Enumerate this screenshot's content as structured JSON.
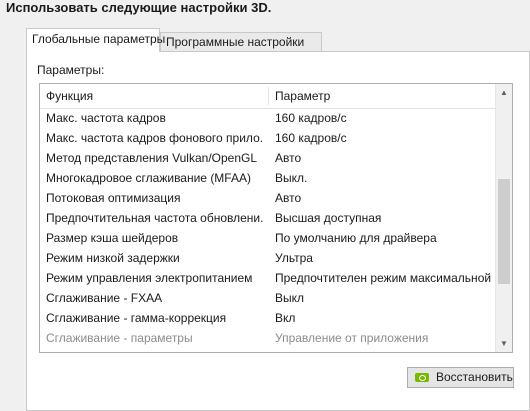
{
  "heading": "Использовать следующие настройки 3D.",
  "tabs": [
    {
      "label": "Глобальные параметры",
      "active": true
    },
    {
      "label": "Программные настройки",
      "active": false
    }
  ],
  "params_label": "Параметры:",
  "table": {
    "columns": [
      "Функция",
      "Параметр"
    ],
    "rows": [
      {
        "feature": "Макс. частота кадров",
        "value": "160 кадров/с",
        "enabled": true
      },
      {
        "feature": "Макс. частота кадров фонового прило...",
        "value": "160 кадров/с",
        "enabled": true
      },
      {
        "feature": "Метод представления Vulkan/OpenGL",
        "value": "Авто",
        "enabled": true
      },
      {
        "feature": "Многокадровое сглаживание (MFAA)",
        "value": "Выкл.",
        "enabled": true
      },
      {
        "feature": "Потоковая оптимизация",
        "value": "Авто",
        "enabled": true
      },
      {
        "feature": "Предпочтительная частота обновлени...",
        "value": "Высшая доступная",
        "enabled": true
      },
      {
        "feature": "Размер кэша шейдеров",
        "value": "По умолчанию для драйвера",
        "enabled": true
      },
      {
        "feature": "Режим низкой задержки",
        "value": "Ультра",
        "enabled": true
      },
      {
        "feature": "Режим управления электропитанием",
        "value": "Предпочтителен режим максимальной п...",
        "enabled": true
      },
      {
        "feature": "Сглаживание - FXAA",
        "value": "Выкл",
        "enabled": true
      },
      {
        "feature": "Сглаживание - гамма-коррекция",
        "value": "Вкл",
        "enabled": true
      },
      {
        "feature": "Сглаживание - параметры",
        "value": "Управление от приложения",
        "enabled": false
      }
    ]
  },
  "scrollbar": {
    "position": 0.45
  },
  "restore_button": {
    "label": "Восстановить",
    "icon": "nvidia-logo-icon"
  }
}
